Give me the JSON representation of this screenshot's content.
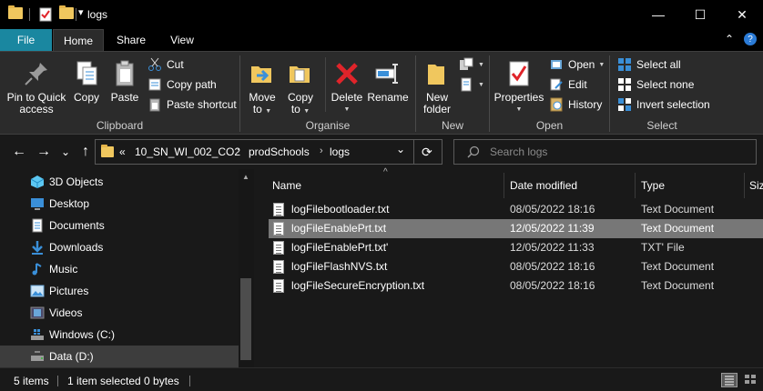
{
  "window": {
    "title": "logs",
    "minimize_glyph": "—",
    "maximize_glyph": "☐",
    "close_glyph": "✕"
  },
  "quick_access": {
    "dropdown_glyph": "▾"
  },
  "ribbon_tabs": {
    "file": "File",
    "home": "Home",
    "share": "Share",
    "view": "View",
    "collapse_glyph": "⌃",
    "help_glyph": "?"
  },
  "clipboard": {
    "pin_line1": "Pin to Quick",
    "pin_line2": "access",
    "copy": "Copy",
    "paste": "Paste",
    "cut": "Cut",
    "copy_path": "Copy path",
    "paste_shortcut": "Paste shortcut",
    "group": "Clipboard"
  },
  "organise": {
    "move_line1": "Move",
    "move_line2": "to",
    "copy_line1": "Copy",
    "copy_line2": "to",
    "delete": "Delete",
    "rename": "Rename",
    "group": "Organise"
  },
  "new_group": {
    "new_folder_line1": "New",
    "new_folder_line2": "folder",
    "group": "New"
  },
  "open_group": {
    "properties": "Properties",
    "open": "Open",
    "edit": "Edit",
    "history": "History",
    "group": "Open"
  },
  "select_group": {
    "select_all": "Select all",
    "select_none": "Select none",
    "invert_selection": "Invert selection",
    "group": "Select"
  },
  "address": {
    "overflow": "«",
    "crumbs": [
      "10_SN_WI_002_CO2",
      "prodSchools",
      "logs"
    ],
    "sep": "›",
    "dropdown_glyph": "⌄",
    "refresh_glyph": "⟳"
  },
  "search": {
    "placeholder": "Search logs"
  },
  "nav_buttons": {
    "back": "←",
    "forward": "→",
    "recent": "⌄",
    "up": "↑"
  },
  "nav_pane": {
    "items": [
      {
        "label": "3D Objects",
        "icon": "3d-objects-icon"
      },
      {
        "label": "Desktop",
        "icon": "desktop-icon"
      },
      {
        "label": "Documents",
        "icon": "documents-icon"
      },
      {
        "label": "Downloads",
        "icon": "downloads-icon"
      },
      {
        "label": "Music",
        "icon": "music-icon"
      },
      {
        "label": "Pictures",
        "icon": "pictures-icon"
      },
      {
        "label": "Videos",
        "icon": "videos-icon"
      },
      {
        "label": "Windows  (C:)",
        "icon": "drive-icon"
      },
      {
        "label": "Data (D:)",
        "icon": "drive-icon"
      }
    ]
  },
  "columns": {
    "name": "Name",
    "date_modified": "Date modified",
    "type": "Type",
    "size": "Siz",
    "sort_glyph": "^"
  },
  "files": [
    {
      "name": "logFilebootloader.txt",
      "date": "08/05/2022 18:16",
      "type": "Text Document",
      "selected": false
    },
    {
      "name": "logFileEnablePrt.txt",
      "date": "12/05/2022 11:39",
      "type": "Text Document",
      "selected": true
    },
    {
      "name": "logFileEnablePrt.txt'",
      "date": "12/05/2022 11:33",
      "type": "TXT' File",
      "selected": false
    },
    {
      "name": "logFileFlashNVS.txt",
      "date": "08/05/2022 18:16",
      "type": "Text Document",
      "selected": false
    },
    {
      "name": "logFileSecureEncryption.txt",
      "date": "08/05/2022 18:16",
      "type": "Text Document",
      "selected": false
    }
  ],
  "status": {
    "item_count": "5 items",
    "selection": "1 item selected  0 bytes"
  },
  "colors": {
    "file_tab": "#1a87a0",
    "ribbon_bg": "#2b2b2b",
    "pane_bg": "#191919",
    "selected_row": "#777777",
    "folder": "#f0c75e",
    "accent_blue": "#3a8fd8",
    "delete_red": "#e0242a"
  }
}
